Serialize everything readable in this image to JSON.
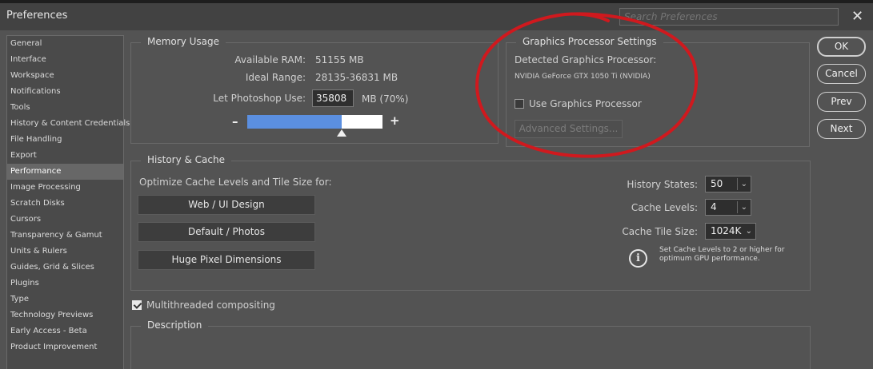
{
  "window": {
    "title": "Preferences"
  },
  "search": {
    "placeholder": "Search Preferences"
  },
  "sidebar": {
    "items": [
      {
        "label": "General"
      },
      {
        "label": "Interface"
      },
      {
        "label": "Workspace"
      },
      {
        "label": "Notifications"
      },
      {
        "label": "Tools"
      },
      {
        "label": "History & Content Credentials"
      },
      {
        "label": "File Handling"
      },
      {
        "label": "Export"
      },
      {
        "label": "Performance"
      },
      {
        "label": "Image Processing"
      },
      {
        "label": "Scratch Disks"
      },
      {
        "label": "Cursors"
      },
      {
        "label": "Transparency & Gamut"
      },
      {
        "label": "Units & Rulers"
      },
      {
        "label": "Guides, Grid & Slices"
      },
      {
        "label": "Plugins"
      },
      {
        "label": "Type"
      },
      {
        "label": "Technology Previews"
      },
      {
        "label": "Early Access - Beta"
      },
      {
        "label": "Product Improvement"
      }
    ],
    "active": "Performance"
  },
  "memory": {
    "title": "Memory Usage",
    "available_label": "Available RAM:",
    "available_value": "51155 MB",
    "ideal_label": "Ideal Range:",
    "ideal_value": "28135-36831 MB",
    "let_use_label": "Let Photoshop Use:",
    "let_use_value": "35808",
    "let_use_unit": "MB (70%)",
    "minus": "–",
    "plus": "+",
    "slider_fraction": 0.7
  },
  "gpu": {
    "title": "Graphics Processor Settings",
    "detected_label": "Detected Graphics Processor:",
    "detected_value": "NVIDIA GeForce GTX 1050 Ti (NVIDIA)",
    "use_gpu_label": "Use Graphics Processor",
    "use_gpu_checked": false,
    "advanced_label": "Advanced Settings..."
  },
  "history_cache": {
    "title": "History & Cache",
    "optimize_label": "Optimize Cache Levels and Tile Size for:",
    "buttons": [
      "Web / UI Design",
      "Default / Photos",
      "Huge Pixel Dimensions"
    ],
    "history_states_label": "History States:",
    "history_states_value": "50",
    "cache_levels_label": "Cache Levels:",
    "cache_levels_value": "4",
    "tile_size_label": "Cache Tile Size:",
    "tile_size_value": "1024K",
    "info_text": "Set Cache Levels to 2 or higher for optimum GPU performance."
  },
  "multithreaded": {
    "label": "Multithreaded compositing",
    "checked": true
  },
  "description": {
    "title": "Description"
  },
  "actions": {
    "ok": "OK",
    "cancel": "Cancel",
    "prev": "Prev",
    "next": "Next"
  },
  "colors": {
    "annotation": "#d0191e",
    "slider_fill": "#5b8fe0"
  }
}
